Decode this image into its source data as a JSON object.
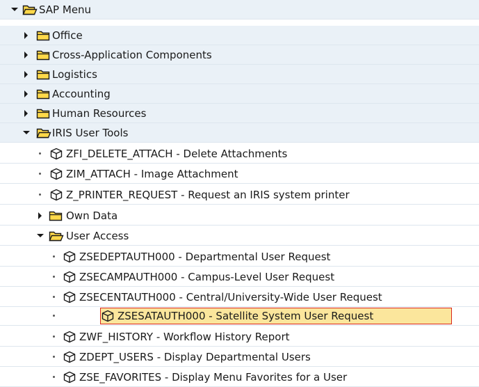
{
  "tree": {
    "root": {
      "label": "SAP Menu",
      "expanded": true
    },
    "folders": [
      {
        "label": "Office",
        "expanded": false
      },
      {
        "label": "Cross-Application Components",
        "expanded": false
      },
      {
        "label": "Logistics",
        "expanded": false
      },
      {
        "label": "Accounting",
        "expanded": false
      },
      {
        "label": "Human Resources",
        "expanded": false
      }
    ],
    "iris": {
      "label": "IRIS User Tools",
      "expanded": true,
      "transactions": [
        {
          "label": "ZFI_DELETE_ATTACH - Delete Attachments"
        },
        {
          "label": "ZIM_ATTACH - Image Attachment"
        },
        {
          "label": "Z_PRINTER_REQUEST - Request an IRIS system printer"
        }
      ],
      "own_data": {
        "label": "Own Data",
        "expanded": false
      },
      "user_access": {
        "label": "User Access",
        "expanded": true,
        "transactions": [
          {
            "label": "ZSEDEPTAUTH000 - Departmental User Request"
          },
          {
            "label": "ZSECAMPAUTH000 - Campus-Level User Request"
          },
          {
            "label": "ZSECENTAUTH000 - Central/University-Wide User Request"
          },
          {
            "label": "ZSESATAUTH000 - Satellite System User Request",
            "selected": true
          },
          {
            "label": "ZWF_HISTORY - Workflow History Report"
          },
          {
            "label": "ZDEPT_USERS - Display Departmental Users"
          },
          {
            "label": "ZSE_FAVORITES - Display Menu Favorites for a User"
          }
        ]
      }
    }
  },
  "colors": {
    "folder_fill": "#ffd94a",
    "folder_stroke": "#1a1a1a",
    "selection_fill": "#fbe69c",
    "selection_border": "#d9261c",
    "section_background": "#eaf1f7"
  },
  "icons": {
    "expand": "triangle-right-icon",
    "collapse": "triangle-down-icon",
    "folder_closed": "folder-icon",
    "folder_open": "folder-open-icon",
    "transaction": "cube-icon",
    "bullet": "bullet-dot-icon"
  }
}
